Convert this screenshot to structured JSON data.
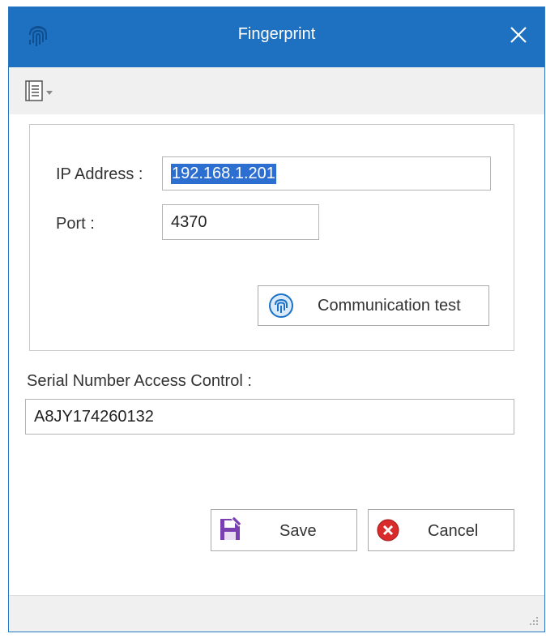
{
  "window": {
    "title": "Fingerprint"
  },
  "icons": {
    "app": "fingerprint-icon",
    "close": "close-icon",
    "toolbar_menu": "list-menu-icon",
    "communication_test": "fingerprint-icon",
    "save": "save-icon",
    "cancel": "cancel-icon",
    "grip": "size-grip-icon"
  },
  "form": {
    "ip_label": "IP Address :",
    "ip_value": "192.168.1.201",
    "port_label": "Port :",
    "port_value": "4370",
    "communication_test_label": "Communication test",
    "serial_label": "Serial Number Access Control :",
    "serial_value": "A8JY174260132"
  },
  "buttons": {
    "save_label": "Save",
    "cancel_label": "Cancel"
  },
  "colors": {
    "titlebar": "#1e70c1",
    "selection": "#2d6fd0",
    "save_icon": "#7a3fb0",
    "cancel_icon": "#d92b2b"
  }
}
